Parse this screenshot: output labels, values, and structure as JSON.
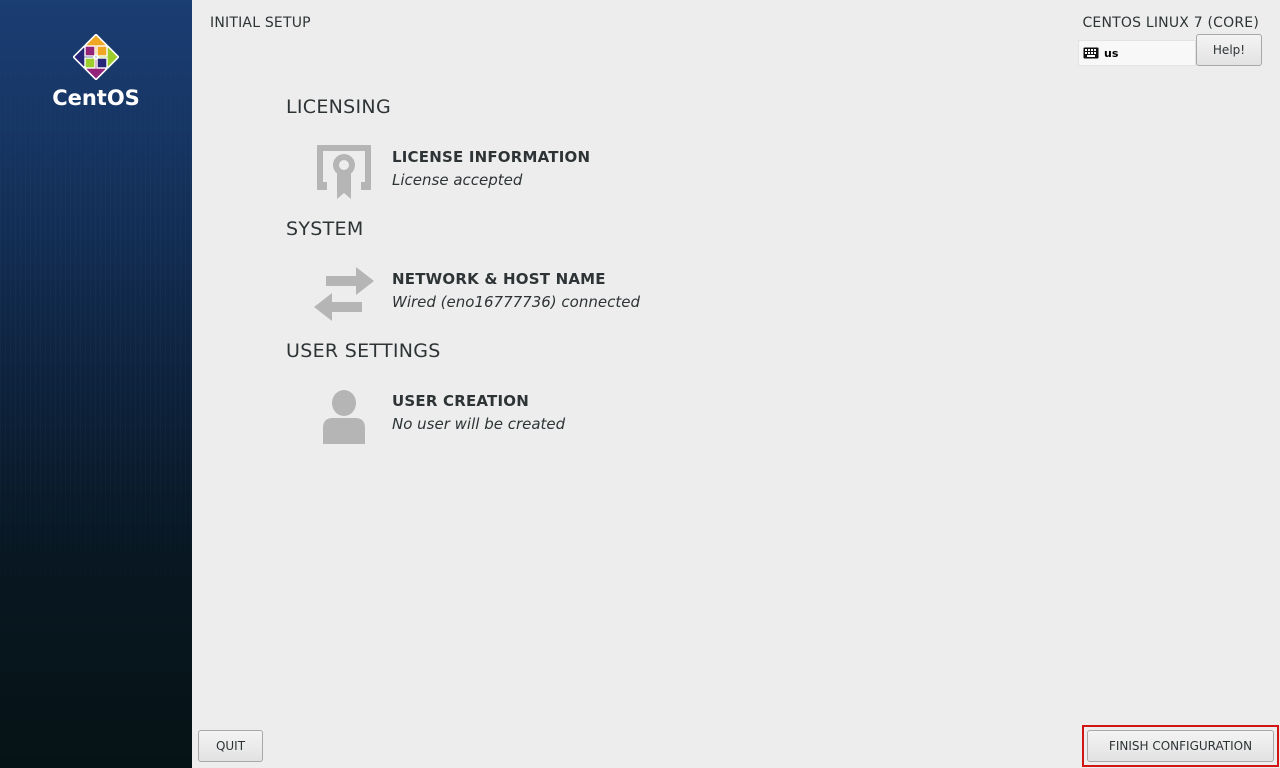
{
  "brand": {
    "logo_text": "CentOS"
  },
  "header": {
    "page_title": "INITIAL SETUP",
    "product_title": "CENTOS LINUX 7 (CORE)",
    "keyboard_layout": "us",
    "help_label": "Help!"
  },
  "sections": [
    {
      "heading": "LICENSING",
      "spokes": [
        {
          "title": "LICENSE INFORMATION",
          "status": "License accepted",
          "icon": "license-icon"
        }
      ]
    },
    {
      "heading": "SYSTEM",
      "spokes": [
        {
          "title": "NETWORK & HOST NAME",
          "status": "Wired (eno16777736) connected",
          "icon": "network-arrows-icon"
        }
      ]
    },
    {
      "heading": "USER SETTINGS",
      "spokes": [
        {
          "title": "USER CREATION",
          "status": "No user will be created",
          "icon": "user-icon"
        }
      ]
    }
  ],
  "footer": {
    "quit_label": "QUIT",
    "finish_label": "FINISH CONFIGURATION"
  },
  "colors": {
    "background": "#ededed",
    "sidebar_top": "#1a3d72",
    "sidebar_bottom": "#061316",
    "text": "#2e3436",
    "icon_gray": "#b5b5b5",
    "highlight_border": "#d11414"
  }
}
